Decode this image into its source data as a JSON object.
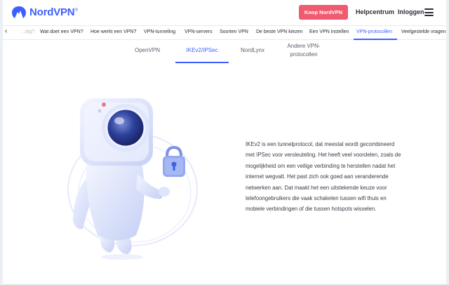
{
  "brand": {
    "name": "NordVPN",
    "trademark": "®"
  },
  "header": {
    "buy_label": "Koop NordVPN",
    "help_label": "Helpcentrum",
    "login_label": "Inloggen"
  },
  "subnav": {
    "items": [
      {
        "label": "..dig?"
      },
      {
        "label": "Wat doet een VPN?"
      },
      {
        "label": "Hoe werkt een VPN?"
      },
      {
        "label": "VPN-tunneling"
      },
      {
        "label": "VPN-servers"
      },
      {
        "label": "Soorten VPN"
      },
      {
        "label": "De beste VPN kiezen"
      },
      {
        "label": "Een VPN instellen"
      },
      {
        "label": "VPN-protocollen"
      },
      {
        "label": "Veelgestelde vragen"
      }
    ],
    "active_index": 8
  },
  "tabs": [
    {
      "label": "OpenVPN"
    },
    {
      "label": "IKEv2/IPSec"
    },
    {
      "label": "NordLynx"
    },
    {
      "label": "Andere VPN-protocollen"
    }
  ],
  "active_tab": 1,
  "content": {
    "lines": [
      "IKEv2 is een tunnelprotocol, dat meestal wordt gecombineerd",
      "met IPSec voor versleuteling. Het heeft veel voordelen, zoals de",
      "mogelijkheid om een veilige verbinding te herstellen nadat het",
      "internet wegvalt. Het past zich ook goed aan veranderende",
      "netwerken aan. Dat maakt het een uitstekende keuze voor",
      "telefoongebruikers die vaak schakelen tussen wifi thuis en",
      "mobiele verbindingen of die tussen hotspots wisselen."
    ]
  },
  "colors": {
    "accent": "#3e5fff",
    "buy_button": "#ef5b6f",
    "text": "#2a2d36"
  }
}
